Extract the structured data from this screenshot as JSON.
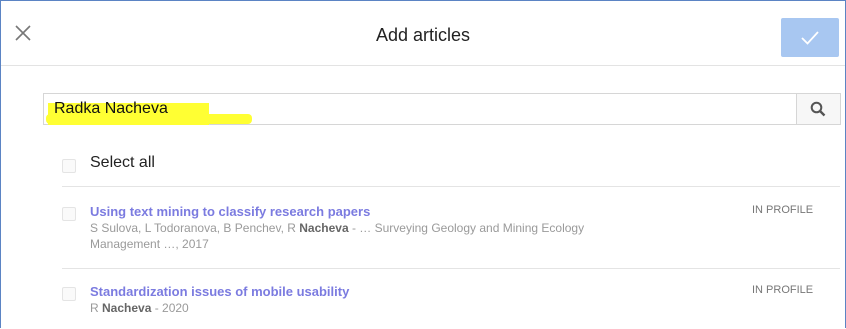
{
  "header": {
    "title": "Add articles",
    "close_icon": "close-icon",
    "confirm_icon": "checkmark-icon"
  },
  "search": {
    "value": "Radka Nacheva",
    "icon": "search-icon",
    "highlight_color": "#ffff33"
  },
  "select_all": {
    "label": "Select all"
  },
  "articles": [
    {
      "title": "Using text mining to classify research papers",
      "authors_pre": "S Sulova, L Todoranova, B Penchev, R ",
      "authors_bold": "Nacheva",
      "authors_post": " - … Surveying Geology and Mining Ecology",
      "venue_line2": "Management …, 2017",
      "badge": "IN PROFILE"
    },
    {
      "title": "Standardization issues of mobile usability",
      "authors_pre": "R ",
      "authors_bold": "Nacheva",
      "authors_post": " - 2020",
      "venue_line2": "",
      "badge": "IN PROFILE"
    }
  ],
  "colors": {
    "accent": "#a8c7f1",
    "link": "#7b7be0",
    "border": "#5b84c4"
  }
}
